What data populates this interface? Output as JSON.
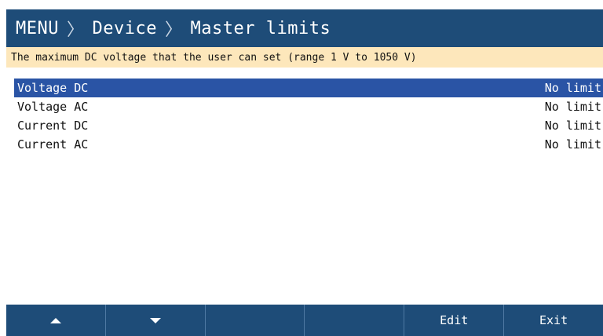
{
  "breadcrumb": {
    "items": [
      "MENU",
      "Device",
      "Master limits"
    ],
    "separator": "〉"
  },
  "hint": "The maximum DC voltage that the user can set (range 1 V to 1050 V)",
  "list": {
    "items": [
      {
        "label": "Voltage DC",
        "value": "No limit",
        "selected": true
      },
      {
        "label": "Voltage AC",
        "value": "No limit",
        "selected": false
      },
      {
        "label": "Current DC",
        "value": "No limit",
        "selected": false
      },
      {
        "label": "Current AC",
        "value": "No limit",
        "selected": false
      }
    ]
  },
  "softkeys": [
    {
      "icon": "arrow-up-icon",
      "label": ""
    },
    {
      "icon": "arrow-down-icon",
      "label": ""
    },
    {
      "icon": "",
      "label": ""
    },
    {
      "icon": "",
      "label": ""
    },
    {
      "icon": "",
      "label": "Edit"
    },
    {
      "icon": "",
      "label": "Exit"
    }
  ],
  "colors": {
    "title_bar": "#1e4c78",
    "hint_bar": "#fde7bb",
    "selection": "#2a54a5",
    "softkey_bar": "#1e4c78"
  }
}
